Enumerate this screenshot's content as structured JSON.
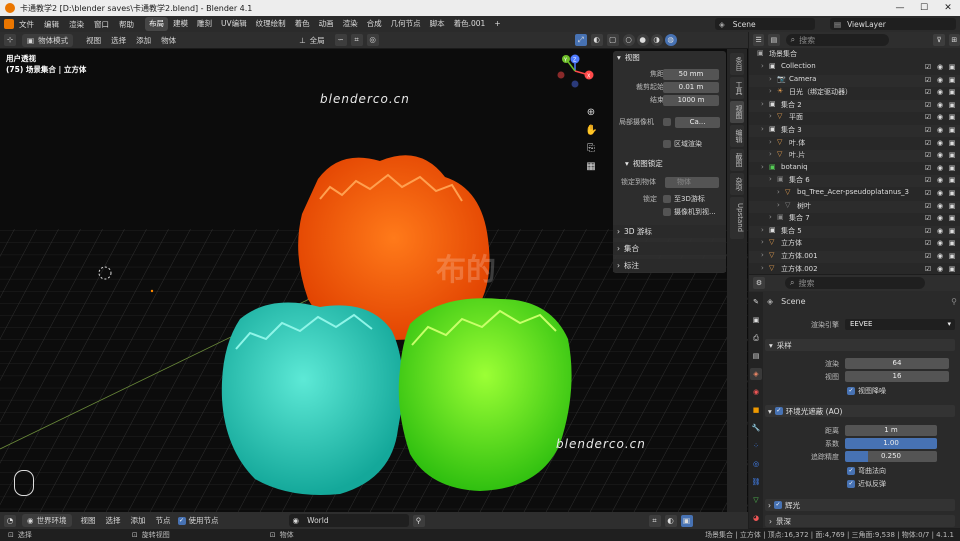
{
  "window": {
    "title": "卡通教学2 [D:\\blender saves\\卡通教学2.blend] - Blender 4.1",
    "minimize": "—",
    "maximize": "☐",
    "close": "✕"
  },
  "menus": [
    "文件",
    "编辑",
    "渲染",
    "窗口",
    "帮助"
  ],
  "workspace_tabs": [
    {
      "label": "布局",
      "active": true
    },
    {
      "label": "建模"
    },
    {
      "label": "雕刻"
    },
    {
      "label": "UV编辑"
    },
    {
      "label": "纹理绘制"
    },
    {
      "label": "着色"
    },
    {
      "label": "动画"
    },
    {
      "label": "渲染"
    },
    {
      "label": "合成"
    },
    {
      "label": "几何节点"
    },
    {
      "label": "脚本"
    },
    {
      "label": "着色.001"
    }
  ],
  "scene_name": "Scene",
  "view_layer": "ViewLayer",
  "toolbar": {
    "mode": "物体模式",
    "view": "视图",
    "select": "选择",
    "add": "添加",
    "object": "物体",
    "transform": "全局"
  },
  "viewport": {
    "view_name": "用户透视",
    "collection_path": "(75) 场景集合 | 立方体",
    "watermark1": "blenderco.cn",
    "watermark2": "blenderco.cn",
    "watermark_cn": "布的",
    "gizmo_x": "X",
    "gizmo_y": "Y",
    "gizmo_z": "Z"
  },
  "npanel": {
    "view_header": "视图",
    "focal_label": "焦距",
    "focal_value": "50 mm",
    "clip_start_label": "裁剪起始",
    "clip_start_value": "0.01 m",
    "clip_end_label": "结束",
    "clip_end_value": "1000 m",
    "local_camera_label": "局部摄像机",
    "local_camera_value": "Ca...",
    "region_render": "区域渲染",
    "view_lock_header": "视图锁定",
    "lock_object_label": "锁定到物体",
    "lock_object_placeholder": "物体",
    "lock_label": "锁定",
    "lock_3d_cursor": "至3D游标",
    "camera_to_view": "摄像机到视...",
    "cursor_header": "3D 游标",
    "collection_header": "集合",
    "annotation_header": "标注"
  },
  "side_tabs": [
    "条目",
    "工具",
    "视图",
    "编辑",
    "截图",
    "杂项",
    "Upstand"
  ],
  "outliner": {
    "search_placeholder": "搜索",
    "root": "场景集合",
    "rows": [
      {
        "label": "Collection",
        "indent": 1
      },
      {
        "label": "Camera",
        "indent": 2
      },
      {
        "label": "日光（绑定驱动器）",
        "indent": 2
      },
      {
        "label": "集合 2",
        "indent": 1
      },
      {
        "label": "平面",
        "indent": 2
      },
      {
        "label": "集合 3",
        "indent": 1
      },
      {
        "label": "叶.体",
        "indent": 2
      },
      {
        "label": "叶.片",
        "indent": 2
      },
      {
        "label": "botaniq",
        "indent": 1
      },
      {
        "label": "集合 6",
        "indent": 2
      },
      {
        "label": "bq_Tree_Acer-pseudoplatanus_3",
        "indent": 3
      },
      {
        "label": "树叶",
        "indent": 3
      },
      {
        "label": "集合 7",
        "indent": 2
      },
      {
        "label": "集合 5",
        "indent": 1
      },
      {
        "label": "立方体",
        "indent": 1
      },
      {
        "label": "立方体.001",
        "indent": 1
      },
      {
        "label": "立方体.002",
        "indent": 1
      }
    ]
  },
  "properties": {
    "search_placeholder": "搜索",
    "scene": "Scene",
    "engine_label": "渲染引擎",
    "engine_value": "EEVEE",
    "sampling_header": "采样",
    "render_label": "渲染",
    "render_value": "64",
    "viewport_label": "视图",
    "viewport_value": "16",
    "viewport_denoise": "视图降噪",
    "ao_header": "环境光遮蔽 (AO)",
    "distance_label": "距离",
    "distance_value": "1 m",
    "factor_label": "系数",
    "factor_value": "1.00",
    "trace_label": "追踪精度",
    "trace_value": "0.250",
    "bent_normals": "弯曲法向",
    "bounces": "近似反弹",
    "bloom_header": "辉光",
    "dof_header": "景深"
  },
  "footer": {
    "world_mode": "世界环境",
    "view": "视图",
    "select": "选择",
    "add": "添加",
    "node": "节点",
    "use_nodes": "使用节点",
    "world": "World"
  },
  "status": {
    "select": "选择",
    "rotate": "旋转视图",
    "object": "物体",
    "stats": "场景集合 | 立方体 | 顶点:16,372 | 面:4,769 | 三角面:9,538 | 物体:0/7 | 4.1.1"
  },
  "colors": {
    "orange": "#ff5a00",
    "teal": "#2ad6c0",
    "green": "#59ee1a",
    "accent": "#4772b3"
  }
}
